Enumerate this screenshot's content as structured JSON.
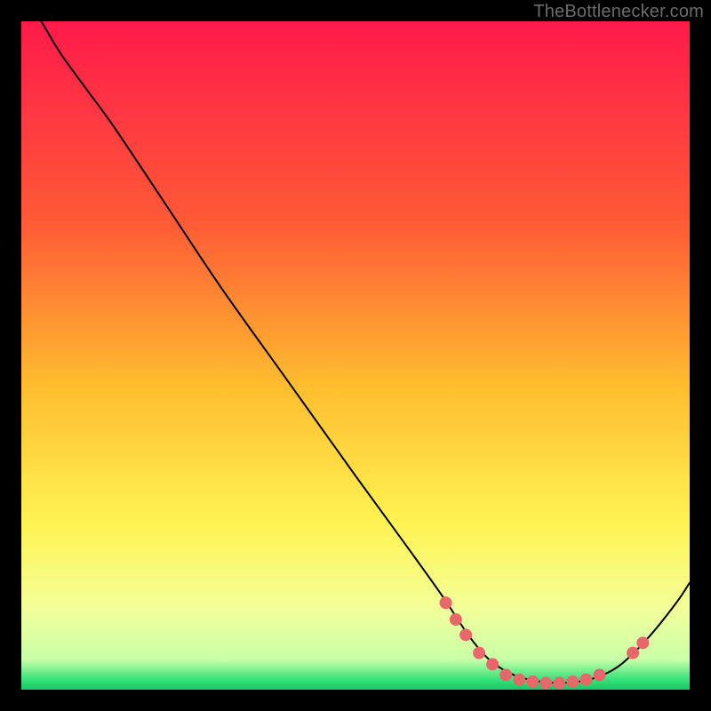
{
  "branding": {
    "text": "TheBottlenecker.com"
  },
  "chart_data": {
    "type": "line",
    "title": "",
    "xlabel": "",
    "ylabel": "",
    "xlim": [
      0,
      100
    ],
    "ylim": [
      0,
      100
    ],
    "background_gradient": {
      "stops": [
        {
          "offset": 0.0,
          "color": "#ff1a4b"
        },
        {
          "offset": 0.3,
          "color": "#ff5a36"
        },
        {
          "offset": 0.55,
          "color": "#ffbe2e"
        },
        {
          "offset": 0.75,
          "color": "#fff351"
        },
        {
          "offset": 0.88,
          "color": "#f2ff9a"
        },
        {
          "offset": 0.955,
          "color": "#c9ffa8"
        },
        {
          "offset": 0.985,
          "color": "#35e27a"
        },
        {
          "offset": 1.0,
          "color": "#19c667"
        }
      ]
    },
    "series": [
      {
        "name": "curve",
        "color": "#000000",
        "stroke_width": 2,
        "points": [
          {
            "x": 3.0,
            "y": 100.0
          },
          {
            "x": 6.0,
            "y": 95.0
          },
          {
            "x": 10.0,
            "y": 89.5
          },
          {
            "x": 14.0,
            "y": 84.0
          },
          {
            "x": 22.0,
            "y": 72.0
          },
          {
            "x": 30.0,
            "y": 60.0
          },
          {
            "x": 40.0,
            "y": 46.0
          },
          {
            "x": 50.0,
            "y": 32.0
          },
          {
            "x": 58.0,
            "y": 21.0
          },
          {
            "x": 63.0,
            "y": 14.0
          },
          {
            "x": 67.0,
            "y": 8.0
          },
          {
            "x": 70.0,
            "y": 4.5
          },
          {
            "x": 73.0,
            "y": 2.5
          },
          {
            "x": 76.0,
            "y": 1.5
          },
          {
            "x": 80.0,
            "y": 1.0
          },
          {
            "x": 84.0,
            "y": 1.3
          },
          {
            "x": 87.0,
            "y": 2.2
          },
          {
            "x": 90.0,
            "y": 4.0
          },
          {
            "x": 94.0,
            "y": 8.0
          },
          {
            "x": 98.0,
            "y": 13.0
          },
          {
            "x": 100.0,
            "y": 16.0
          }
        ]
      }
    ],
    "markers": {
      "name": "bottom-cluster",
      "color": "#e8676a",
      "radius": 7,
      "points": [
        {
          "x": 63.5,
          "y": 13.0
        },
        {
          "x": 65.0,
          "y": 10.5
        },
        {
          "x": 66.5,
          "y": 8.2
        },
        {
          "x": 68.5,
          "y": 5.5
        },
        {
          "x": 70.5,
          "y": 3.8
        },
        {
          "x": 72.5,
          "y": 2.2
        },
        {
          "x": 74.5,
          "y": 1.5
        },
        {
          "x": 76.5,
          "y": 1.2
        },
        {
          "x": 78.5,
          "y": 1.0
        },
        {
          "x": 80.5,
          "y": 1.0
        },
        {
          "x": 82.5,
          "y": 1.2
        },
        {
          "x": 84.5,
          "y": 1.5
        },
        {
          "x": 86.5,
          "y": 2.2
        },
        {
          "x": 91.5,
          "y": 5.5
        },
        {
          "x": 93.0,
          "y": 7.0
        }
      ]
    }
  }
}
